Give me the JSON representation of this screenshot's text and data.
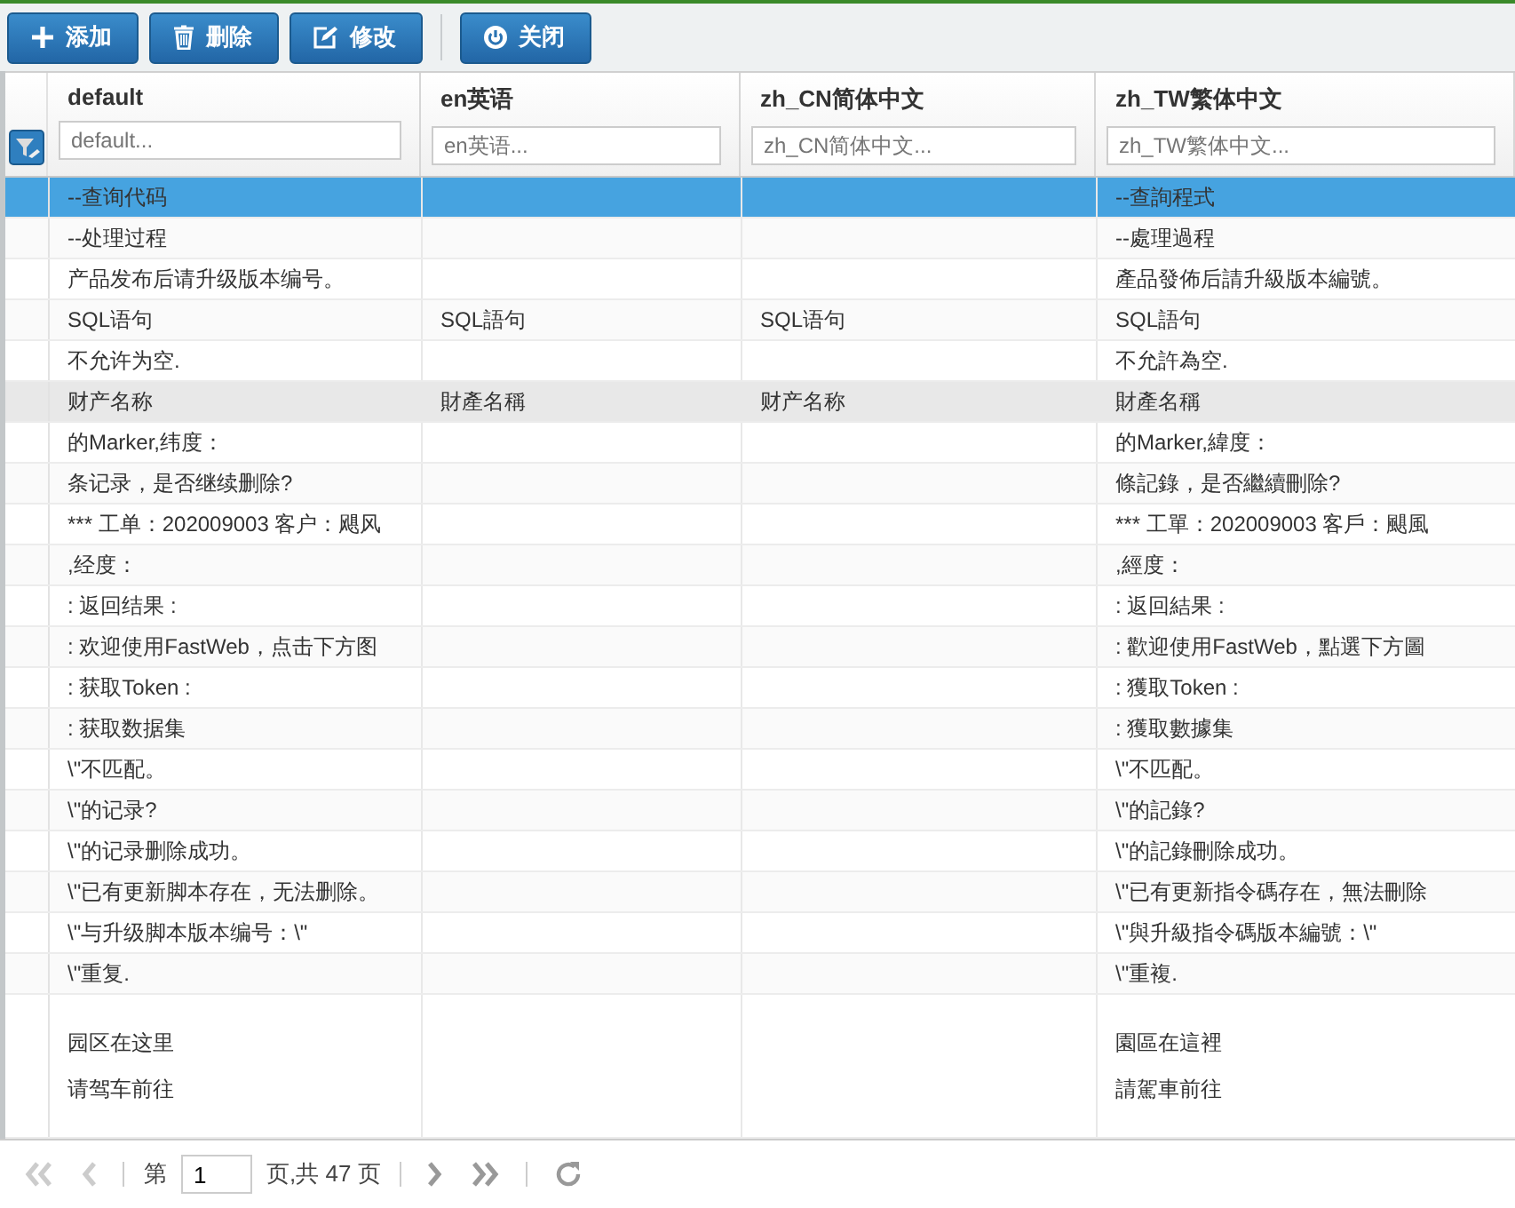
{
  "toolbar": {
    "groups": [
      [
        {
          "kind": "add",
          "label": "添加"
        },
        {
          "kind": "delete",
          "label": "删除"
        },
        {
          "kind": "edit",
          "label": "修改"
        }
      ],
      [
        {
          "kind": "close",
          "label": "关闭"
        }
      ]
    ]
  },
  "table": {
    "columns": [
      {
        "title": "default",
        "placeholder": "default..."
      },
      {
        "title": "en英语",
        "placeholder": "en英语..."
      },
      {
        "title": "zh_CN简体中文",
        "placeholder": "zh_CN简体中文..."
      },
      {
        "title": "zh_TW繁体中文",
        "placeholder": "zh_TW繁体中文..."
      }
    ],
    "rows": [
      {
        "selected": true,
        "highlighted": false,
        "cells": [
          "--查询代码",
          null,
          null,
          "--查詢程式"
        ]
      },
      {
        "selected": false,
        "highlighted": false,
        "cells": [
          "--处理过程",
          null,
          null,
          "--處理過程"
        ]
      },
      {
        "selected": false,
        "highlighted": false,
        "cells": [
          "产品发布后请升级版本编号。",
          null,
          null,
          "產品發佈后請升級版本編號。"
        ]
      },
      {
        "selected": false,
        "highlighted": false,
        "cells": [
          "SQL语句",
          "SQL語句",
          "SQL语句",
          "SQL語句"
        ]
      },
      {
        "selected": false,
        "highlighted": false,
        "cells": [
          "不允许为空.",
          null,
          null,
          "不允許為空."
        ]
      },
      {
        "selected": false,
        "highlighted": true,
        "cells": [
          "财产名称",
          "財產名稱",
          "财产名称",
          "財產名稱"
        ]
      },
      {
        "selected": false,
        "highlighted": false,
        "cells": [
          "的Marker,纬度：",
          null,
          null,
          "的Marker,緯度："
        ]
      },
      {
        "selected": false,
        "highlighted": false,
        "cells": [
          "条记录，是否继续删除?",
          null,
          null,
          "條記錄，是否繼續刪除?"
        ]
      },
      {
        "selected": false,
        "highlighted": false,
        "cells": [
          "*** 工单：202009003 客户：飓风",
          null,
          null,
          "*** 工單：202009003 客戶：颶風"
        ]
      },
      {
        "selected": false,
        "highlighted": false,
        "cells": [
          ",经度：",
          null,
          null,
          ",經度："
        ]
      },
      {
        "selected": false,
        "highlighted": false,
        "cells": [
          ": 返回结果 :",
          null,
          null,
          ": 返回結果 :"
        ]
      },
      {
        "selected": false,
        "highlighted": false,
        "cells": [
          ": 欢迎使用FastWeb，点击下方图",
          null,
          null,
          ": 歡迎使用FastWeb，點選下方圖"
        ]
      },
      {
        "selected": false,
        "highlighted": false,
        "cells": [
          ": 获取Token :",
          null,
          null,
          ": 獲取Token :"
        ]
      },
      {
        "selected": false,
        "highlighted": false,
        "cells": [
          ": 获取数据集",
          null,
          null,
          ": 獲取數據集"
        ]
      },
      {
        "selected": false,
        "highlighted": false,
        "cells": [
          "\\\"不匹配。",
          null,
          null,
          "\\\"不匹配。"
        ]
      },
      {
        "selected": false,
        "highlighted": false,
        "cells": [
          "\\\"的记录?",
          null,
          null,
          "\\\"的記錄?"
        ]
      },
      {
        "selected": false,
        "highlighted": false,
        "cells": [
          "\\\"的记录删除成功。",
          null,
          null,
          "\\\"的記錄刪除成功。"
        ]
      },
      {
        "selected": false,
        "highlighted": false,
        "cells": [
          "\\\"已有更新脚本存在，无法删除。",
          null,
          null,
          "\\\"已有更新指令碼存在，無法刪除"
        ]
      },
      {
        "selected": false,
        "highlighted": false,
        "cells": [
          "\\\"与升级脚本版本编号：\\\"",
          null,
          null,
          "\\\"與升級指令碼版本編號：\\\""
        ]
      },
      {
        "selected": false,
        "highlighted": false,
        "cells": [
          "\\\"重复.",
          null,
          null,
          "\\\"重複."
        ]
      },
      {
        "selected": false,
        "highlighted": false,
        "cells": [
          [
            "园区在这里",
            "请驾车前往"
          ],
          null,
          null,
          [
            "園區在這裡",
            "請駕車前往"
          ]
        ]
      }
    ]
  },
  "pager": {
    "first": {
      "disabled": true
    },
    "prev": {
      "disabled": true
    },
    "page_label": "第",
    "page_value": "1",
    "total_label": "页,共 47 页",
    "next": {
      "disabled": false
    },
    "last": {
      "disabled": false
    }
  }
}
